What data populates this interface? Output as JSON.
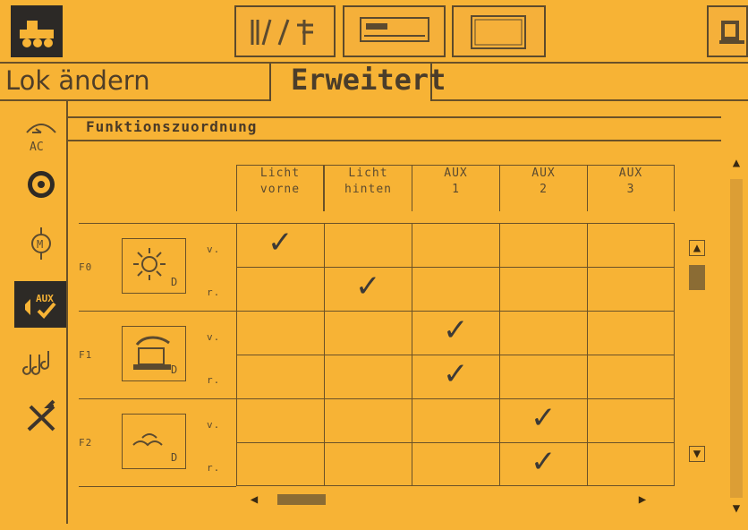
{
  "tabs": {
    "left": "Lok ändern",
    "active": "Erweitert"
  },
  "panel": {
    "title": "Funktionszuordnung"
  },
  "sidebar": {
    "items": [
      {
        "label": "AC",
        "icon": "ac-icon"
      },
      {
        "label": "",
        "icon": "steering-wheel-icon"
      },
      {
        "label": "",
        "icon": "motor-icon"
      },
      {
        "label": "AUX",
        "icon": "aux-check-icon"
      },
      {
        "label": "",
        "icon": "music-icon"
      },
      {
        "label": "",
        "icon": "tools-icon"
      }
    ]
  },
  "columns": [
    {
      "line1": "Licht",
      "line2": "vorne"
    },
    {
      "line1": "Licht",
      "line2": "hinten"
    },
    {
      "line1": "AUX",
      "line2": "1"
    },
    {
      "line1": "AUX",
      "line2": "2"
    },
    {
      "line1": "AUX",
      "line2": "3"
    }
  ],
  "functions": [
    {
      "label": "F0",
      "icon": "light-icon",
      "badge": "D",
      "rows": [
        {
          "dir": "v.",
          "checks": [
            true,
            false,
            false,
            false,
            false
          ]
        },
        {
          "dir": "r.",
          "checks": [
            false,
            true,
            false,
            false,
            false
          ]
        }
      ]
    },
    {
      "label": "F1",
      "icon": "smoke-icon",
      "badge": "D",
      "rows": [
        {
          "dir": "v.",
          "checks": [
            false,
            false,
            true,
            false,
            false
          ]
        },
        {
          "dir": "r.",
          "checks": [
            false,
            false,
            true,
            false,
            false
          ]
        }
      ]
    },
    {
      "label": "F2",
      "icon": "wave-icon",
      "badge": "D",
      "rows": [
        {
          "dir": "v.",
          "checks": [
            false,
            false,
            false,
            true,
            false
          ]
        },
        {
          "dir": "r.",
          "checks": [
            false,
            false,
            false,
            true,
            false
          ]
        }
      ]
    }
  ]
}
